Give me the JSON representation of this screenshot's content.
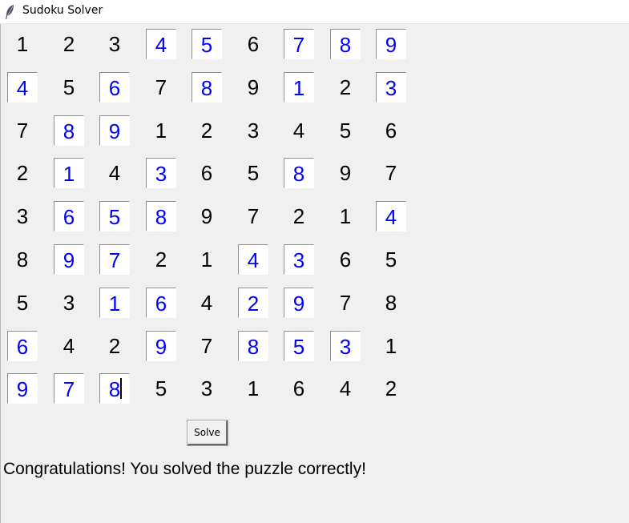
{
  "window": {
    "title": "Sudoku Solver",
    "icon": "feather-icon"
  },
  "colors": {
    "given": "#000000",
    "entry": "#0000ff",
    "background": "#f0f0f0"
  },
  "board": {
    "rows": [
      [
        {
          "v": "1",
          "e": false
        },
        {
          "v": "2",
          "e": false
        },
        {
          "v": "3",
          "e": false
        },
        {
          "v": "4",
          "e": true
        },
        {
          "v": "5",
          "e": true
        },
        {
          "v": "6",
          "e": false
        },
        {
          "v": "7",
          "e": true
        },
        {
          "v": "8",
          "e": true
        },
        {
          "v": "9",
          "e": true
        }
      ],
      [
        {
          "v": "4",
          "e": true
        },
        {
          "v": "5",
          "e": false
        },
        {
          "v": "6",
          "e": true
        },
        {
          "v": "7",
          "e": false
        },
        {
          "v": "8",
          "e": true
        },
        {
          "v": "9",
          "e": false
        },
        {
          "v": "1",
          "e": true
        },
        {
          "v": "2",
          "e": false
        },
        {
          "v": "3",
          "e": true
        }
      ],
      [
        {
          "v": "7",
          "e": false
        },
        {
          "v": "8",
          "e": true
        },
        {
          "v": "9",
          "e": true
        },
        {
          "v": "1",
          "e": false
        },
        {
          "v": "2",
          "e": false
        },
        {
          "v": "3",
          "e": false
        },
        {
          "v": "4",
          "e": false
        },
        {
          "v": "5",
          "e": false
        },
        {
          "v": "6",
          "e": false
        }
      ],
      [
        {
          "v": "2",
          "e": false
        },
        {
          "v": "1",
          "e": true
        },
        {
          "v": "4",
          "e": false
        },
        {
          "v": "3",
          "e": true
        },
        {
          "v": "6",
          "e": false
        },
        {
          "v": "5",
          "e": false
        },
        {
          "v": "8",
          "e": true
        },
        {
          "v": "9",
          "e": false
        },
        {
          "v": "7",
          "e": false
        }
      ],
      [
        {
          "v": "3",
          "e": false
        },
        {
          "v": "6",
          "e": true
        },
        {
          "v": "5",
          "e": true
        },
        {
          "v": "8",
          "e": true
        },
        {
          "v": "9",
          "e": false
        },
        {
          "v": "7",
          "e": false
        },
        {
          "v": "2",
          "e": false
        },
        {
          "v": "1",
          "e": false
        },
        {
          "v": "4",
          "e": true
        }
      ],
      [
        {
          "v": "8",
          "e": false
        },
        {
          "v": "9",
          "e": true
        },
        {
          "v": "7",
          "e": true
        },
        {
          "v": "2",
          "e": false
        },
        {
          "v": "1",
          "e": false
        },
        {
          "v": "4",
          "e": true
        },
        {
          "v": "3",
          "e": true
        },
        {
          "v": "6",
          "e": false
        },
        {
          "v": "5",
          "e": false
        }
      ],
      [
        {
          "v": "5",
          "e": false
        },
        {
          "v": "3",
          "e": false
        },
        {
          "v": "1",
          "e": true
        },
        {
          "v": "6",
          "e": true
        },
        {
          "v": "4",
          "e": false
        },
        {
          "v": "2",
          "e": true
        },
        {
          "v": "9",
          "e": true
        },
        {
          "v": "7",
          "e": false
        },
        {
          "v": "8",
          "e": false
        }
      ],
      [
        {
          "v": "6",
          "e": true
        },
        {
          "v": "4",
          "e": false
        },
        {
          "v": "2",
          "e": false
        },
        {
          "v": "9",
          "e": true
        },
        {
          "v": "7",
          "e": false
        },
        {
          "v": "8",
          "e": true
        },
        {
          "v": "5",
          "e": true
        },
        {
          "v": "3",
          "e": true
        },
        {
          "v": "1",
          "e": false
        }
      ],
      [
        {
          "v": "9",
          "e": true
        },
        {
          "v": "7",
          "e": true
        },
        {
          "v": "8",
          "e": true
        },
        {
          "v": "5",
          "e": false
        },
        {
          "v": "3",
          "e": false
        },
        {
          "v": "1",
          "e": false
        },
        {
          "v": "6",
          "e": false
        },
        {
          "v": "4",
          "e": false
        },
        {
          "v": "2",
          "e": false
        }
      ]
    ]
  },
  "controls": {
    "solve_label": "Solve"
  },
  "status": {
    "message": "Congratulations! You solved the puzzle correctly!"
  }
}
